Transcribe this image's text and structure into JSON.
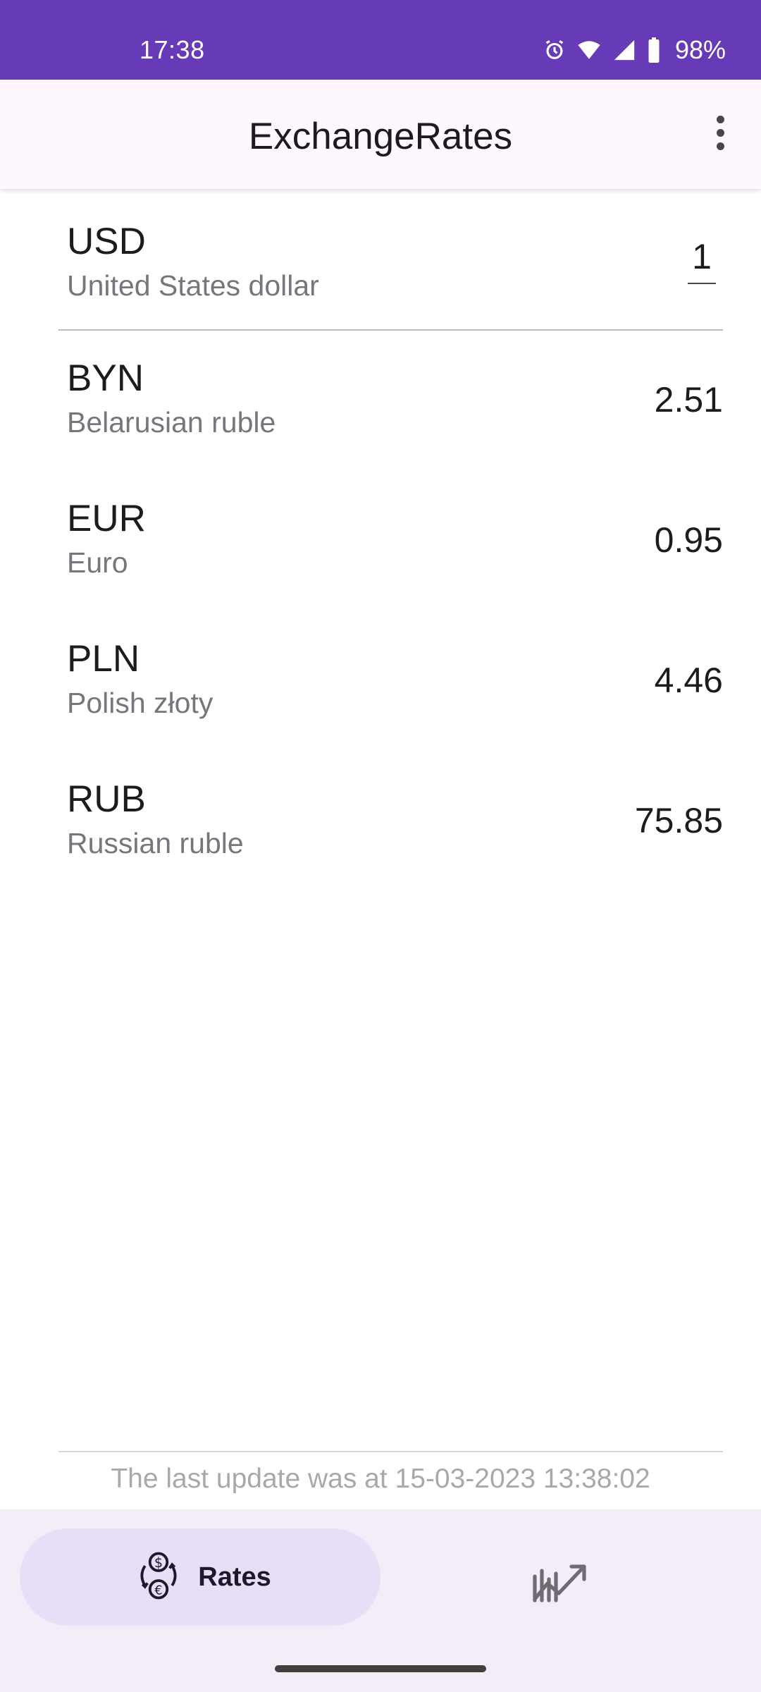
{
  "status_bar": {
    "time": "17:38",
    "battery": "98%",
    "icons": [
      "alarm-icon",
      "wifi-icon",
      "signal-icon",
      "battery-icon"
    ]
  },
  "app_bar": {
    "title": "ExchangeRates",
    "menu_icon": "more-vert-icon"
  },
  "base_currency": {
    "code": "USD",
    "name": "United States dollar",
    "amount": "1"
  },
  "rates": [
    {
      "code": "BYN",
      "name": "Belarusian ruble",
      "value": "2.51"
    },
    {
      "code": "EUR",
      "name": "Euro",
      "value": "0.95"
    },
    {
      "code": "PLN",
      "name": "Polish złoty",
      "value": "4.46"
    },
    {
      "code": "RUB",
      "name": "Russian ruble",
      "value": "75.85"
    }
  ],
  "footer": {
    "last_update": "The last update was at 15-03-2023 13:38:02"
  },
  "bottom_nav": {
    "items": [
      {
        "label": "Rates",
        "icon": "currency-exchange-icon",
        "selected": true
      },
      {
        "label": "",
        "icon": "trending-chart-icon",
        "selected": false
      }
    ]
  },
  "colors": {
    "status_bar": "#673ab7",
    "app_bar": "#fef7ff",
    "nav_background": "#f3edf7",
    "nav_active_pill": "#e8def8",
    "secondary_text": "#79757d"
  }
}
